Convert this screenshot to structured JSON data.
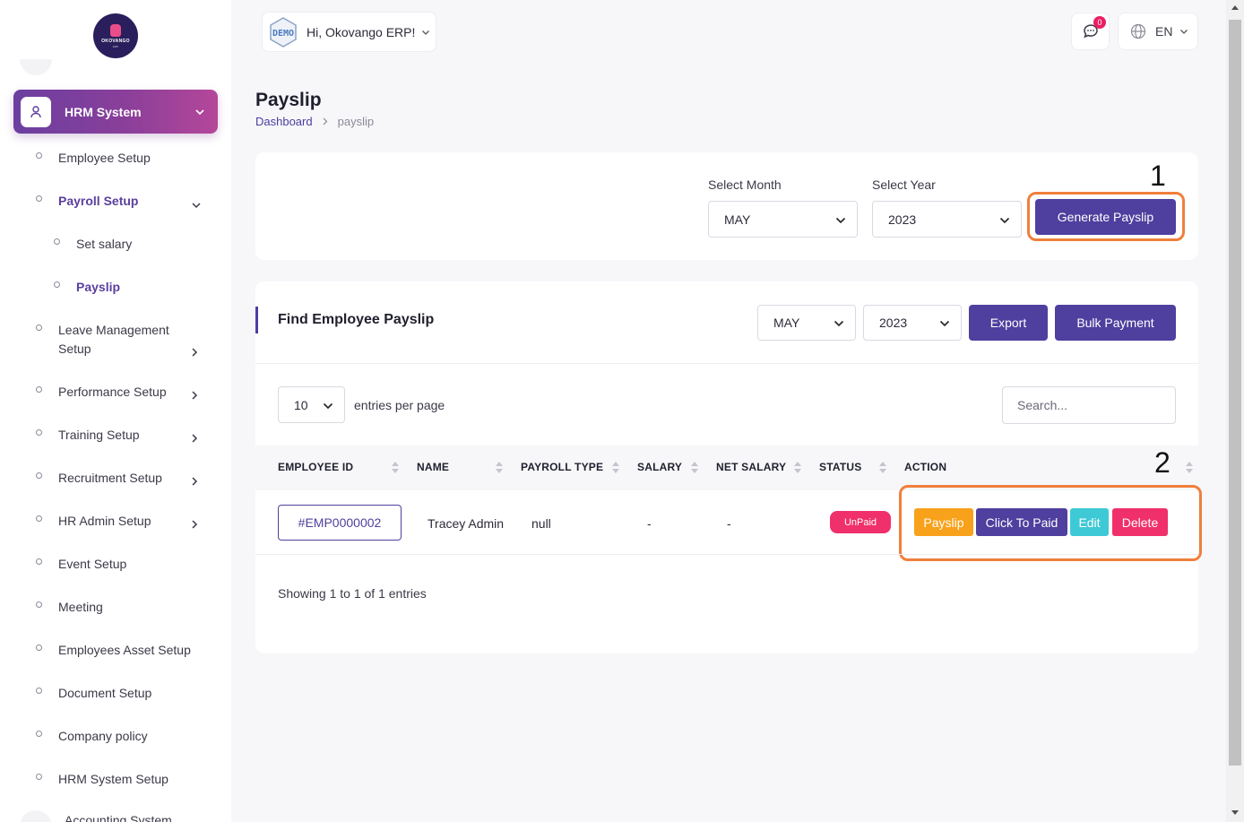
{
  "brand": {
    "logo_text": "OKOVANGO",
    "logo_sub": "ERP"
  },
  "sidebar": {
    "module": "HRM System",
    "items": [
      {
        "label": "Employee Setup"
      },
      {
        "label": "Payroll Setup"
      },
      {
        "label": "Set salary"
      },
      {
        "label": "Payslip"
      },
      {
        "label": "Leave Management Setup"
      },
      {
        "label": "Performance Setup"
      },
      {
        "label": "Training Setup"
      },
      {
        "label": "Recruitment Setup"
      },
      {
        "label": "HR Admin Setup"
      },
      {
        "label": "Event Setup"
      },
      {
        "label": "Meeting"
      },
      {
        "label": "Employees Asset Setup"
      },
      {
        "label": "Document Setup"
      },
      {
        "label": "Company policy"
      },
      {
        "label": "HRM System Setup"
      },
      {
        "label": "Accounting System"
      }
    ]
  },
  "topbar": {
    "demo_badge": "DEMO",
    "greeting": "Hi, Okovango ERP!",
    "notification_count": "0",
    "language": "EN"
  },
  "page": {
    "title": "Payslip",
    "breadcrumb": {
      "home": "Dashboard",
      "current": "payslip"
    }
  },
  "generate": {
    "month_label": "Select Month",
    "month_value": "MAY",
    "year_label": "Select Year",
    "year_value": "2023",
    "button": "Generate Payslip",
    "annotation": "1"
  },
  "find": {
    "title": "Find Employee Payslip",
    "month_value": "MAY",
    "year_value": "2023",
    "export_button": "Export",
    "bulk_button": "Bulk Payment",
    "entries_value": "10",
    "entries_label": "entries per page",
    "search_placeholder": "Search...",
    "columns": [
      "EMPLOYEE ID",
      "NAME",
      "PAYROLL TYPE",
      "SALARY",
      "NET SALARY",
      "STATUS",
      "ACTION"
    ],
    "rows": [
      {
        "employee_id": "#EMP0000002",
        "name": "Tracey Admin",
        "payroll_type": "null",
        "salary": "-",
        "net_salary": "-",
        "status": "UnPaid",
        "actions": [
          "Payslip",
          "Click To Paid",
          "Edit",
          "Delete"
        ]
      }
    ],
    "annotation": "2",
    "showing": "Showing 1 to 1 of 1 entries"
  },
  "colors": {
    "primary": "#4f3f9e",
    "highlight": "#f07f3c",
    "payslip_btn": "#f8a11a",
    "edit_btn": "#3ec9d6",
    "delete_btn": "#f0306b",
    "unpaid": "#f0306b"
  }
}
